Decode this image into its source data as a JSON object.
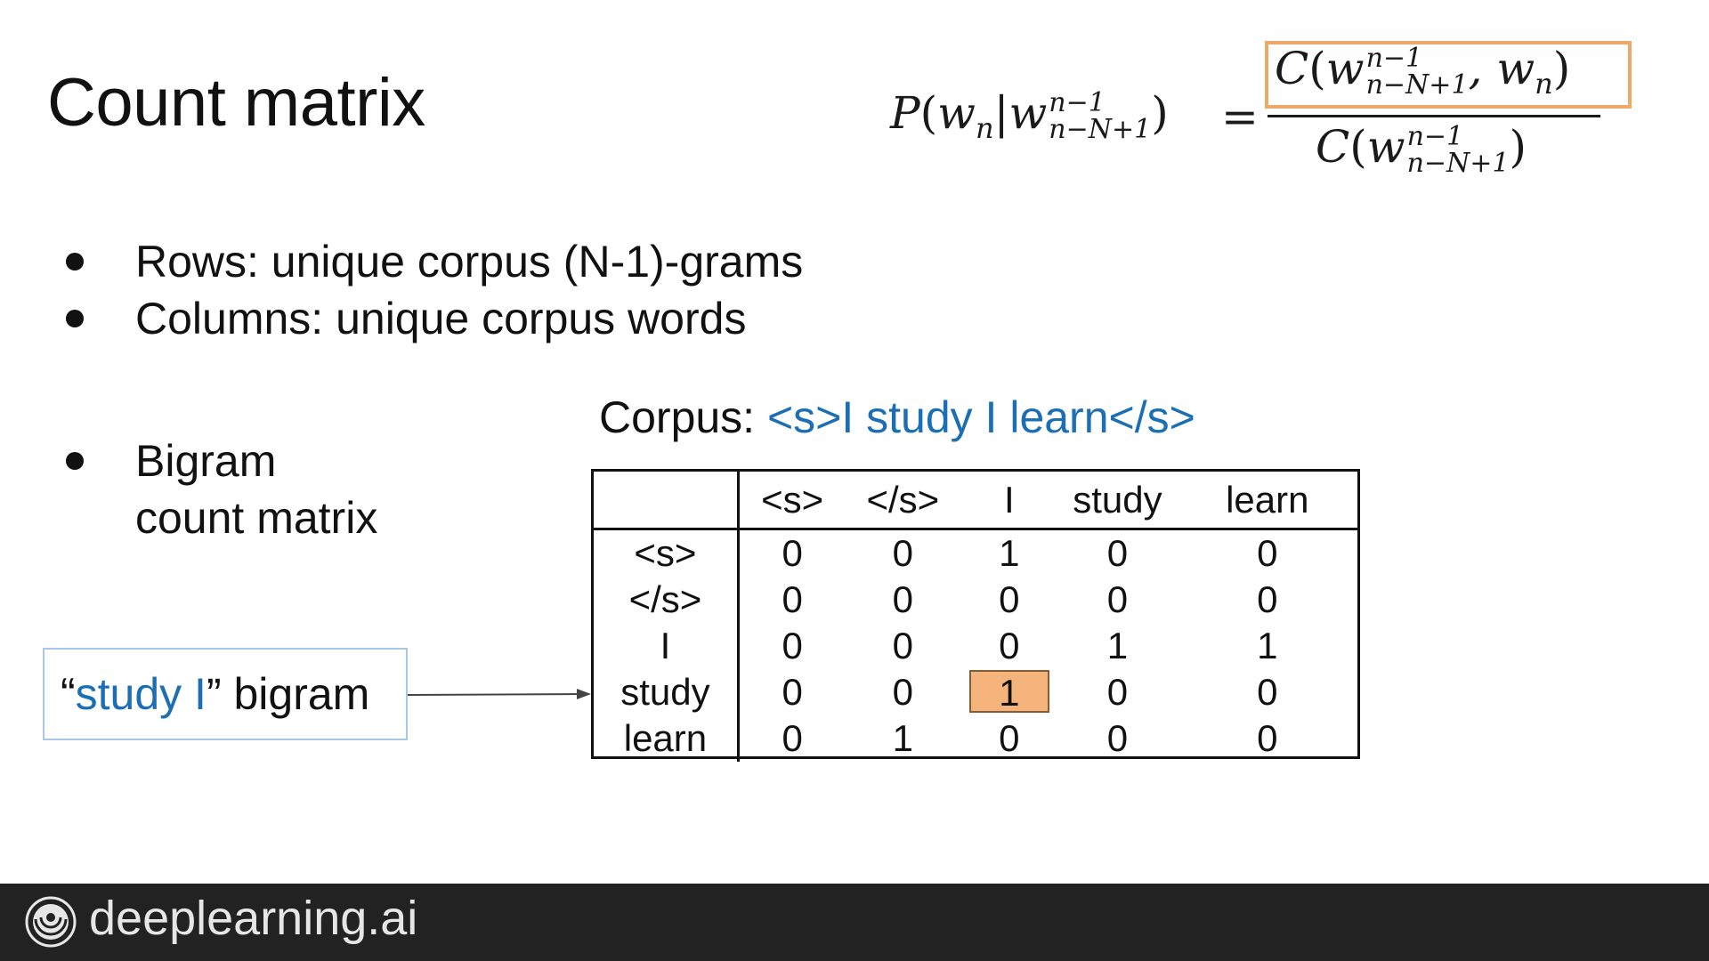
{
  "title": "Count matrix",
  "formula": {
    "lhs_P": "P",
    "lhs_w": "w",
    "lhs_sub_n": "n",
    "lhs_w2": "w",
    "sup": "n−1",
    "sub": "n−N+1",
    "equals": "=",
    "num_C": "C",
    "num_w": "w",
    "num_sup": "n−1",
    "num_sub": "n−N+1",
    "num_comma_w": ", w",
    "num_wn_sub": "n",
    "den_C": "C",
    "den_w": "w",
    "den_sup": "n−1",
    "den_sub": "n−N+1",
    "highlight_color": "#f0a868"
  },
  "bullets": [
    "Rows: unique corpus (N-1)-grams",
    "Columns: unique corpus words"
  ],
  "bigram_bullet": {
    "line1": "Bigram",
    "line2": "count matrix"
  },
  "corpus": {
    "label": "Corpus: ",
    "text": "<s>I study I learn</s>",
    "text_color": "#1c6fb4"
  },
  "matrix": {
    "columns": [
      "<s>",
      "</s>",
      "I",
      "study",
      "learn"
    ],
    "rows": [
      {
        "label": "<s>",
        "values": [
          "0",
          "0",
          "1",
          "0",
          "0"
        ]
      },
      {
        "label": "</s>",
        "values": [
          "0",
          "0",
          "0",
          "0",
          "0"
        ]
      },
      {
        "label": "I",
        "values": [
          "0",
          "0",
          "0",
          "1",
          "1"
        ]
      },
      {
        "label": "study",
        "values": [
          "0",
          "0",
          "1",
          "0",
          "0"
        ]
      },
      {
        "label": "learn",
        "values": [
          "0",
          "1",
          "0",
          "0",
          "0"
        ]
      }
    ],
    "highlight": {
      "row": 3,
      "col": 2,
      "color": "#f4b47c"
    }
  },
  "callout": {
    "open_quote": "“",
    "highlight": "study I",
    "close_quote": "”",
    "rest": " bigram"
  },
  "footer": {
    "brand": "deeplearning.ai",
    "background": "#222222"
  }
}
